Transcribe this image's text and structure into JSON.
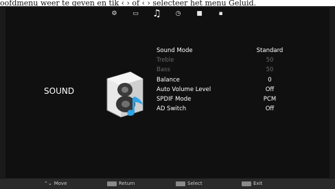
{
  "header_text": "oofdmenu weer te geven en tik ‹ › of ‹ › selecteer het menu Geluid.",
  "tabs": [
    {
      "icon": "gear-icon",
      "glyph": "⚙"
    },
    {
      "icon": "monitor-icon",
      "glyph": "▭"
    },
    {
      "icon": "music-note-icon",
      "glyph": "♫"
    },
    {
      "icon": "clock-icon",
      "glyph": "◷"
    },
    {
      "icon": "lock-icon",
      "glyph": "■"
    },
    {
      "icon": "grid-icon",
      "glyph": "▪"
    }
  ],
  "section_title": "SOUND",
  "menu": [
    {
      "label": "Sound Mode",
      "value": "Standard",
      "enabled": true
    },
    {
      "label": "Treble",
      "value": "50",
      "enabled": false
    },
    {
      "label": "Bass",
      "value": "50",
      "enabled": false
    },
    {
      "label": "Balance",
      "value": "0",
      "enabled": true
    },
    {
      "label": "Auto Volume Level",
      "value": "Off",
      "enabled": true
    },
    {
      "label": "SPDIF Mode",
      "value": "PCM",
      "enabled": true
    },
    {
      "label": "AD Switch",
      "value": "Off",
      "enabled": true
    }
  ],
  "footer": {
    "move": {
      "key": "⌃⌄",
      "label": "Move"
    },
    "return": {
      "label": "Return"
    },
    "select": {
      "label": "Select"
    },
    "exit": {
      "label": "Exit"
    }
  }
}
